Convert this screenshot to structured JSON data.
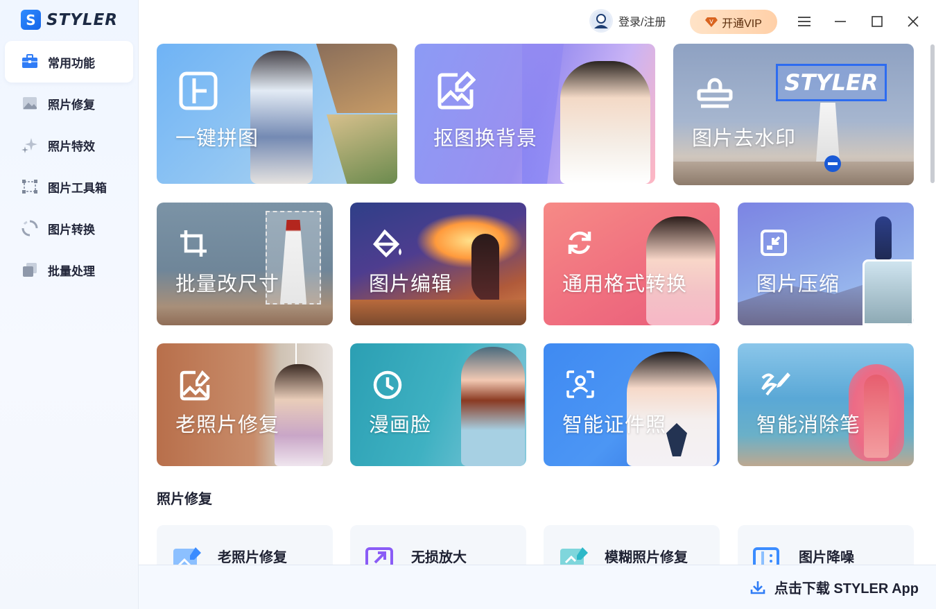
{
  "app": {
    "logo_text": "STYLER",
    "logo_mark": "S"
  },
  "sidebar": {
    "items": [
      {
        "label": "常用功能",
        "icon": "toolbox-icon",
        "active": true
      },
      {
        "label": "照片修复",
        "icon": "photo-icon"
      },
      {
        "label": "照片特效",
        "icon": "sparkle-icon"
      },
      {
        "label": "图片工具箱",
        "icon": "crop-frame-icon"
      },
      {
        "label": "图片转换",
        "icon": "convert-icon"
      },
      {
        "label": "批量处理",
        "icon": "stack-icon"
      }
    ]
  },
  "header": {
    "login_label": "登录/注册",
    "vip_label": "开通VIP",
    "vip_badge": "V"
  },
  "features": [
    {
      "label": "一键拼图",
      "icon": "collage-icon"
    },
    {
      "label": "抠图换背景",
      "icon": "image-edit-icon"
    },
    {
      "label": "图片去水印",
      "icon": "stamp-icon",
      "watermark": "STYLER"
    },
    {
      "label": "批量改尺寸",
      "icon": "crop-icon"
    },
    {
      "label": "图片编辑",
      "icon": "paint-bucket-icon"
    },
    {
      "label": "通用格式转换",
      "icon": "refresh-icon"
    },
    {
      "label": "图片压缩",
      "icon": "compress-icon"
    },
    {
      "label": "老照片修复",
      "icon": "photo-repair-icon"
    },
    {
      "label": "漫画脸",
      "icon": "clock-icon"
    },
    {
      "label": "智能证件照",
      "icon": "id-photo-icon"
    },
    {
      "label": "智能消除笔",
      "icon": "eraser-pen-icon"
    }
  ],
  "photo_repair_section": {
    "title": "照片修复",
    "items": [
      {
        "label": "老照片修复",
        "icon": "photo-repair-icon",
        "color": "#3b8cff"
      },
      {
        "label": "无损放大",
        "icon": "upscale-icon",
        "color": "#8a5cf6"
      },
      {
        "label": "模糊照片修复",
        "icon": "blur-fix-icon",
        "color": "#2db8c8"
      },
      {
        "label": "图片降噪",
        "icon": "denoise-icon",
        "color": "#3b8cff"
      }
    ]
  },
  "download": {
    "label": "点击下载 STYLER App"
  }
}
